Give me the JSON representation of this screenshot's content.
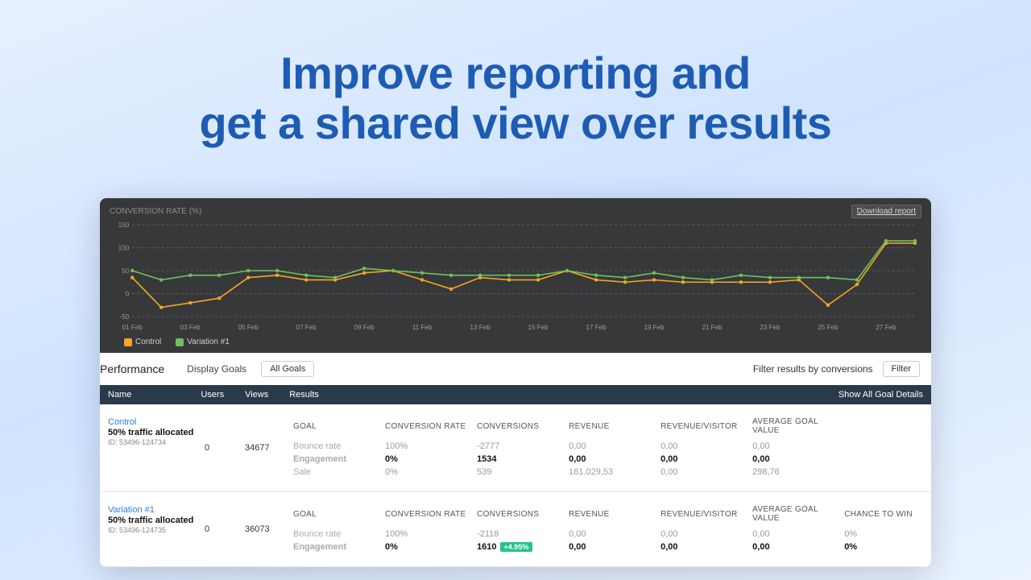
{
  "hero": {
    "line1": "Improve reporting and",
    "line2": "get a shared view over results"
  },
  "chart": {
    "title": "CONVERSION RATE (%)",
    "download_label": "Download report",
    "legend": {
      "control": "Control",
      "variation": "Variation #1"
    }
  },
  "chart_data": {
    "type": "line",
    "title": "CONVERSION RATE (%)",
    "xlabel": "",
    "ylabel": "Conversion rate (%)",
    "ylim": [
      -50,
      150
    ],
    "categories": [
      "01 Feb",
      "02 Feb",
      "03 Feb",
      "04 Feb",
      "05 Feb",
      "06 Feb",
      "07 Feb",
      "08 Feb",
      "09 Feb",
      "10 Feb",
      "11 Feb",
      "12 Feb",
      "13 Feb",
      "14 Feb",
      "15 Feb",
      "16 Feb",
      "17 Feb",
      "18 Feb",
      "19 Feb",
      "20 Feb",
      "21 Feb",
      "22 Feb",
      "23 Feb",
      "24 Feb",
      "25 Feb",
      "26 Feb",
      "27 Feb",
      "28 Feb"
    ],
    "x_ticks_shown": [
      "01 Feb",
      "03 Feb",
      "05 Feb",
      "07 Feb",
      "09 Feb",
      "11 Feb",
      "13 Feb",
      "15 Feb",
      "17 Feb",
      "19 Feb",
      "21 Feb",
      "23 Feb",
      "25 Feb",
      "27 Feb"
    ],
    "series": [
      {
        "name": "Control",
        "color": "#f5a623",
        "values": [
          35,
          -30,
          -20,
          -10,
          35,
          40,
          30,
          30,
          45,
          50,
          30,
          10,
          35,
          30,
          30,
          50,
          30,
          25,
          30,
          25,
          25,
          25,
          25,
          30,
          -25,
          20,
          110,
          110
        ]
      },
      {
        "name": "Variation #1",
        "color": "#70c060",
        "values": [
          50,
          30,
          40,
          40,
          50,
          50,
          40,
          35,
          55,
          50,
          45,
          40,
          40,
          40,
          40,
          50,
          40,
          35,
          45,
          35,
          30,
          40,
          35,
          35,
          35,
          30,
          115,
          115
        ]
      }
    ]
  },
  "performance": {
    "title": "Performance",
    "display_goals": "Display Goals",
    "all_goals": "All Goals",
    "filter_by": "Filter results by conversions",
    "filter_btn": "Filter"
  },
  "strip": {
    "name": "Name",
    "users": "Users",
    "views": "Views",
    "results": "Results",
    "show_all": "Show All Goal Details"
  },
  "metric_headers": {
    "goal": "GOAL",
    "conversion_rate": "CONVERSION RATE",
    "conversions": "CONVERSIONS",
    "revenue": "REVENUE",
    "revenue_visitor": "REVENUE/VISITOR",
    "avg_goal_value": "AVERAGE GOAL VALUE",
    "chance_to_win": "CHANCE TO WIN"
  },
  "rows": [
    {
      "name": "Control",
      "alloc": "50% traffic allocated",
      "id": "ID: 53496-124734",
      "users": "0",
      "views": "34677",
      "goals": [
        {
          "goal": "Bounce rate",
          "cr": "100%",
          "conv": "-2777",
          "rev": "0,00",
          "rv": "0,00",
          "agv": "0,00",
          "ctw": ""
        },
        {
          "goal": "Engagement",
          "cr": "0%",
          "conv": "1534",
          "rev": "0,00",
          "rv": "0,00",
          "agv": "0,00",
          "ctw": "",
          "bold": true
        },
        {
          "goal": "Sale",
          "cr": "0%",
          "conv": "539",
          "rev": "161.029,53",
          "rv": "0,00",
          "agv": "298,76",
          "ctw": ""
        }
      ]
    },
    {
      "name": "Variation #1",
      "alloc": "50% traffic allocated",
      "id": "ID: 53496-124735",
      "users": "0",
      "views": "36073",
      "show_ctw": true,
      "goals": [
        {
          "goal": "Bounce rate",
          "cr": "100%",
          "conv": "-2118",
          "rev": "0,00",
          "rv": "0,00",
          "agv": "0,00",
          "ctw": "0%"
        },
        {
          "goal": "Engagement",
          "cr": "0%",
          "conv": "1610",
          "badge": "+4.95%",
          "rev": "0,00",
          "rv": "0,00",
          "agv": "0,00",
          "ctw": "0%",
          "bold": true
        }
      ]
    }
  ]
}
